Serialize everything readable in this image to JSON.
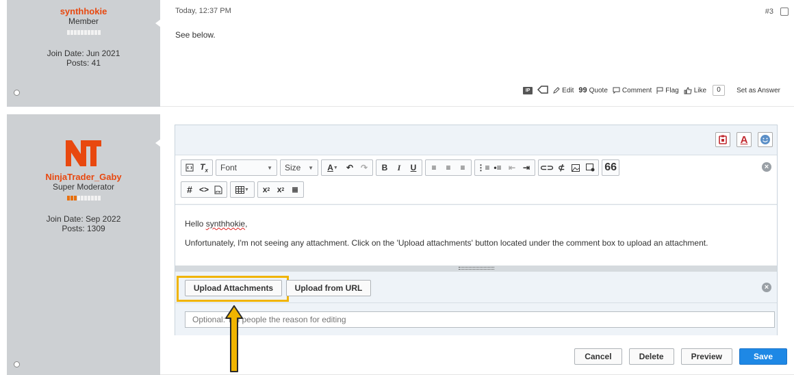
{
  "post1": {
    "username": "synthhokie",
    "role": "Member",
    "reputation_bars_filled": 0,
    "join_date": "Join Date: Jun 2021",
    "posts": "Posts: 41",
    "timestamp": "Today, 12:37 PM",
    "post_number": "#3",
    "body": "See below.",
    "actions": {
      "ip_label": "IP",
      "edit": "Edit",
      "quote": "Quote",
      "comment": "Comment",
      "flag": "Flag",
      "like": "Like",
      "like_count": "0",
      "set_as_answer": "Set as Answer"
    }
  },
  "post2": {
    "username": "NinjaTrader_Gaby",
    "role": "Super Moderator",
    "reputation_bars_filled": 3,
    "join_date": "Join Date: Sep 2022",
    "posts": "Posts: 1309"
  },
  "editor": {
    "toolbar": {
      "font_label": "Font",
      "size_label": "Size",
      "bold": "B",
      "italic": "I",
      "underline": "U",
      "hashtag": "#",
      "code": "<>",
      "quote_glyph": "66"
    },
    "content": {
      "greeting_prefix": "Hello ",
      "greeting_name": "synthhokie",
      "greeting_suffix": ",",
      "message": "Unfortunately, I'm not seeing any attachment. Click on the 'Upload attachments' button located under the comment box to upload an attachment."
    },
    "upload_attachments": "Upload Attachments",
    "upload_from_url": "Upload from URL",
    "reason_placeholder": "Optional: Tell people the reason for editing"
  },
  "buttons": {
    "cancel": "Cancel",
    "delete": "Delete",
    "preview": "Preview",
    "save": "Save"
  },
  "colors": {
    "username": "#e8480f",
    "accent_blue": "#1e88e5",
    "highlight": "#f0b400",
    "sidebar_bg": "#cdd0d3"
  }
}
